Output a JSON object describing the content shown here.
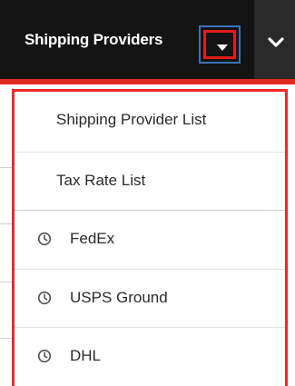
{
  "navbar": {
    "module_label": "Shipping Providers",
    "toggle_icon": "caret-down-icon",
    "more_icon": "chevron-down-icon",
    "accent_color": "#e42a24"
  },
  "menu": {
    "links": [
      {
        "label": "Shipping Provider List"
      },
      {
        "label": "Tax Rate List"
      }
    ],
    "recent_items": [
      {
        "label": "FedEx",
        "icon": "clock-icon"
      },
      {
        "label": "USPS Ground",
        "icon": "clock-icon"
      },
      {
        "label": "DHL",
        "icon": "clock-icon"
      }
    ],
    "highlight_color": "#ea2a2a"
  }
}
